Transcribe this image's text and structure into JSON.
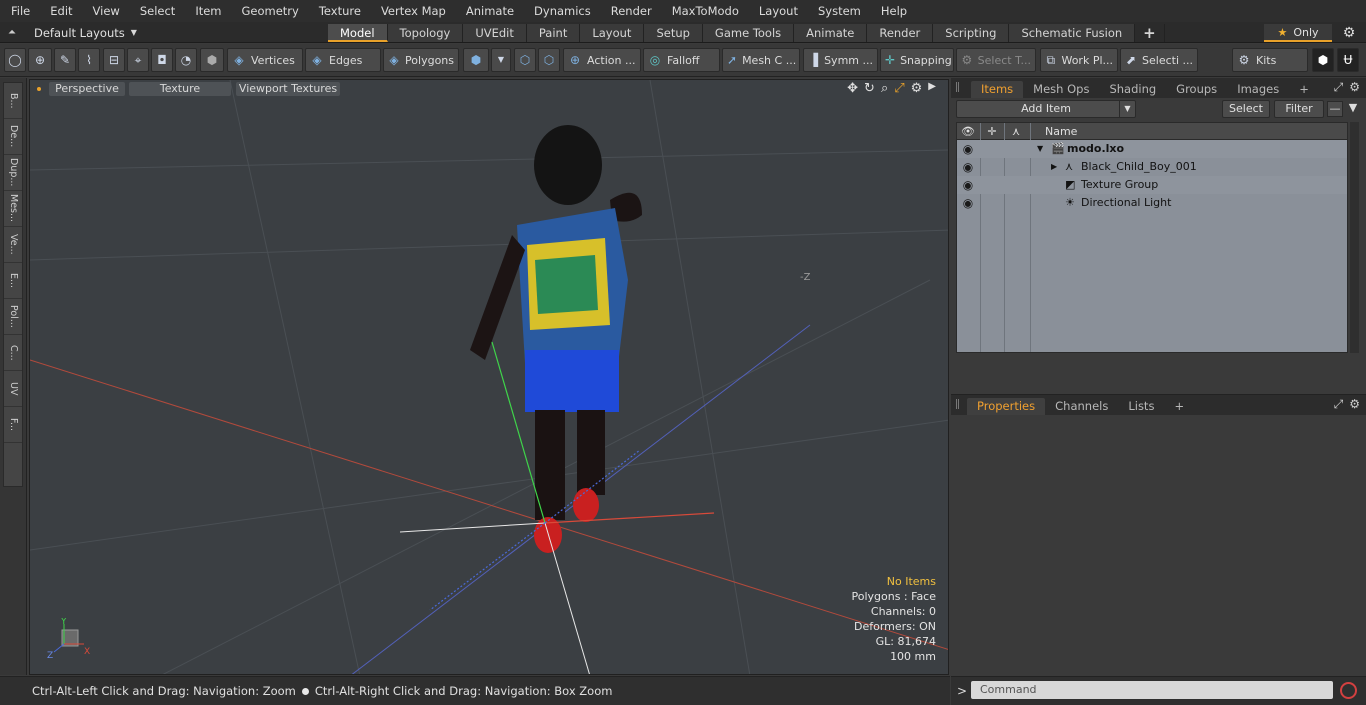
{
  "menu": [
    "File",
    "Edit",
    "View",
    "Select",
    "Item",
    "Geometry",
    "Texture",
    "Vertex Map",
    "Animate",
    "Dynamics",
    "Render",
    "MaxToModo",
    "Layout",
    "System",
    "Help"
  ],
  "layout_selector": "Default Layouts",
  "workspace_tabs": [
    "Model",
    "Topology",
    "UVEdit",
    "Paint",
    "Layout",
    "Setup",
    "Game Tools",
    "Animate",
    "Render",
    "Scripting",
    "Schematic Fusion"
  ],
  "active_tab": "Model",
  "only_label": "Only",
  "toolbar": {
    "vertices": "Vertices",
    "edges": "Edges",
    "polygons": "Polygons",
    "action": "Action ...",
    "falloff": "Falloff",
    "mesh_c": "Mesh C ...",
    "symm": "Symm ...",
    "snapping": "Snapping",
    "select_t": "Select T...",
    "work_pl": "Work Pl...",
    "selecti": "Selecti ...",
    "kits": "Kits"
  },
  "left_tabs": [
    "B...",
    "De...",
    "Dup...",
    "Mes...",
    "Ve...",
    "E...",
    "Pol...",
    "C...",
    "UV",
    "F..."
  ],
  "viewport": {
    "buttons": [
      "Perspective",
      "Texture",
      "Viewport Textures"
    ],
    "info": {
      "selection": "No Items",
      "polygons": "Polygons : Face",
      "channels": "Channels: 0",
      "deformers": "Deformers: ON",
      "gl": "GL: 81,674",
      "scale": "100 mm"
    },
    "axis_labels": {
      "x": "X",
      "y": "Y",
      "z": "Z"
    },
    "neg_z_label": "-Z"
  },
  "items_panel": {
    "tabs": [
      "Items",
      "Mesh Ops",
      "Shading",
      "Groups",
      "Images"
    ],
    "active_tab": "Items",
    "add_item": "Add Item",
    "select": "Select",
    "filter": "Filter",
    "column_name": "Name",
    "rows": [
      {
        "label": "modo.lxo",
        "indent": 0,
        "bold": true,
        "icon": "scene-icon"
      },
      {
        "label": "Black_Child_Boy_001",
        "indent": 1,
        "bold": false,
        "icon": "mesh-icon"
      },
      {
        "label": "Texture Group",
        "indent": 1,
        "bold": false,
        "icon": "texture-group-icon"
      },
      {
        "label": "Directional Light",
        "indent": 1,
        "bold": false,
        "icon": "light-icon"
      }
    ]
  },
  "properties_panel": {
    "tabs": [
      "Properties",
      "Channels",
      "Lists"
    ],
    "active_tab": "Properties"
  },
  "status": {
    "hint_left": "Ctrl-Alt-Left Click and Drag: Navigation: Zoom",
    "hint_right": "Ctrl-Alt-Right Click and Drag: Navigation: Box Zoom"
  },
  "command": {
    "placeholder": "Command",
    "prompt": ">"
  },
  "colors": {
    "accent": "#e8a12a",
    "viewport_bg": "#3b3f43",
    "x_axis": "#d84a3a",
    "y_axis": "#3fd44a",
    "z_axis": "#4a6ad8"
  }
}
